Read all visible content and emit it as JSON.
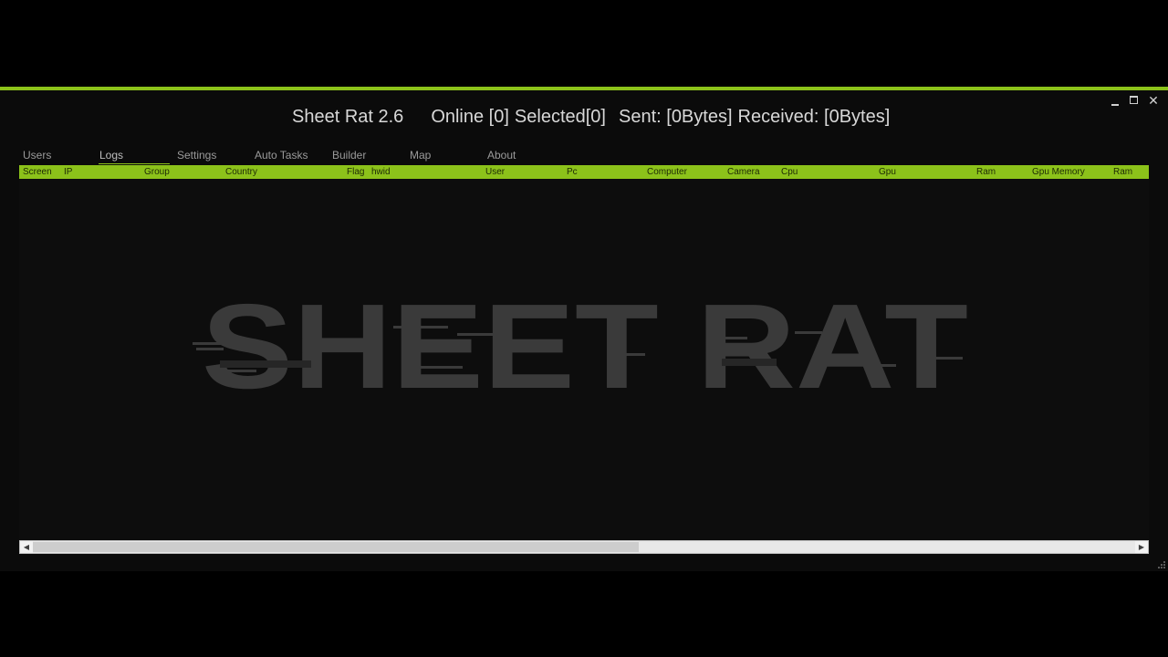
{
  "window": {
    "app_name": "Sheet Rat 2.6",
    "online": "Online [0]",
    "selected": "Selected[0]",
    "sent": "Sent: [0Bytes]",
    "received": "Received: [0Bytes]",
    "minimize_icon": "minimize-icon",
    "maximize_icon": "maximize-icon",
    "close_icon": "close-icon",
    "close_glyph": "✕"
  },
  "tabs": [
    {
      "label": "Users"
    },
    {
      "label": "Logs"
    },
    {
      "label": "Settings"
    },
    {
      "label": "Auto Tasks"
    },
    {
      "label": "Builder"
    },
    {
      "label": "Map"
    },
    {
      "label": "About"
    }
  ],
  "active_tab": "Logs",
  "columns": [
    "Screen",
    "IP",
    "Group",
    "Country",
    "Flag",
    "hwid",
    "User",
    "Pc",
    "Computer",
    "Camera",
    "Cpu",
    "Gpu",
    "Ram",
    "Gpu Memory",
    "Ram"
  ],
  "watermark": {
    "text": "SHEET RAT"
  },
  "scrollbar": {
    "left_arrow": "◀",
    "right_arrow": "▶",
    "position": 0.55
  },
  "colors": {
    "accent": "#8cc21a",
    "background": "#0b0b0b",
    "watermark": "#3a3a3a"
  }
}
